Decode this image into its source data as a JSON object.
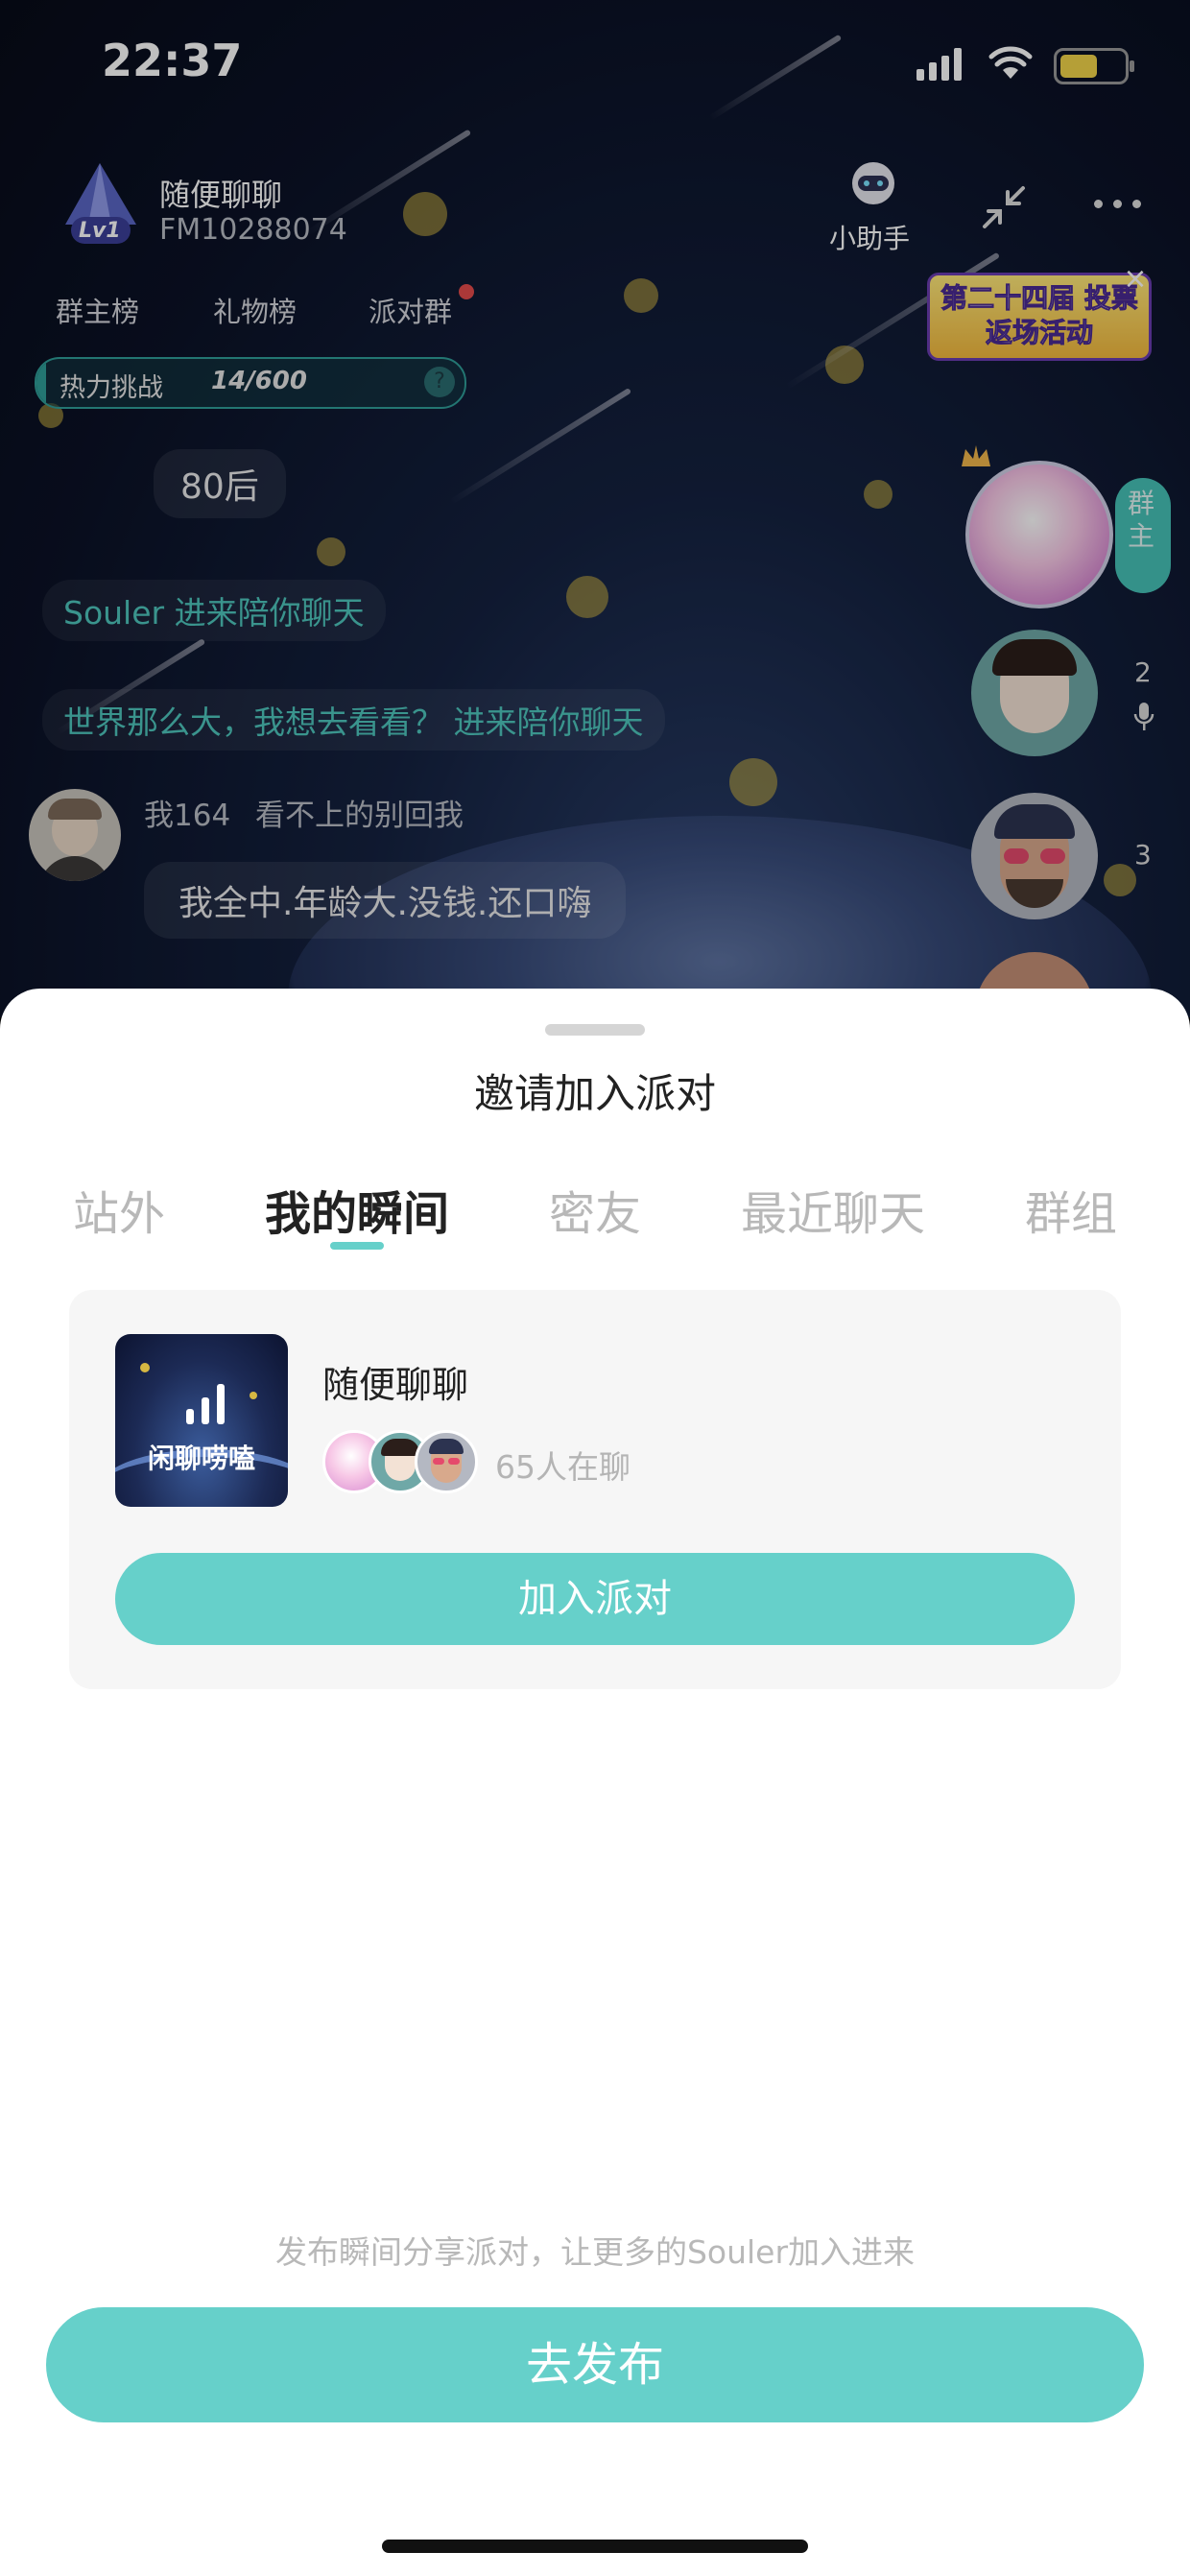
{
  "status_bar": {
    "time": "22:37"
  },
  "room": {
    "title": "随便聊聊",
    "fm_id": "FM10288074",
    "level": "Lv1",
    "assistant_label": "小助手",
    "rank_tabs": [
      "群主榜",
      "礼物榜",
      "派对群"
    ],
    "challenge": {
      "label": "热力挑战",
      "progress": "14/600",
      "value": 14,
      "max": 600
    },
    "banner_text": "第二十四届 投票返场活动",
    "messages": [
      {
        "type": "bubble",
        "text": "80后"
      },
      {
        "type": "teal",
        "text": "Souler 进来陪你聊天"
      },
      {
        "type": "teal",
        "text": "世界那么大，我想去看看？ 进来陪你聊天"
      },
      {
        "type": "user",
        "name": "我164",
        "remark": "看不上的别回我",
        "text": "我全中.年龄大.没钱.还口嗨"
      }
    ],
    "seats": [
      {
        "badge": "群主"
      },
      {
        "number": "2"
      },
      {
        "number": "3"
      }
    ]
  },
  "sheet": {
    "title": "邀请加入派对",
    "tabs": [
      "站外",
      "我的瞬间",
      "密友",
      "最近聊天",
      "群组"
    ],
    "active_tab_index": 1,
    "party_card": {
      "thumb_label": "闲聊唠嗑",
      "name": "随便聊聊",
      "online_count": "65人在聊",
      "join_label": "加入派对"
    },
    "hint": "发布瞬间分享派对，让更多的Souler加入进来",
    "publish_label": "去发布"
  },
  "colors": {
    "accent": "#66d0ca",
    "teal_text": "#4ec6bd"
  }
}
